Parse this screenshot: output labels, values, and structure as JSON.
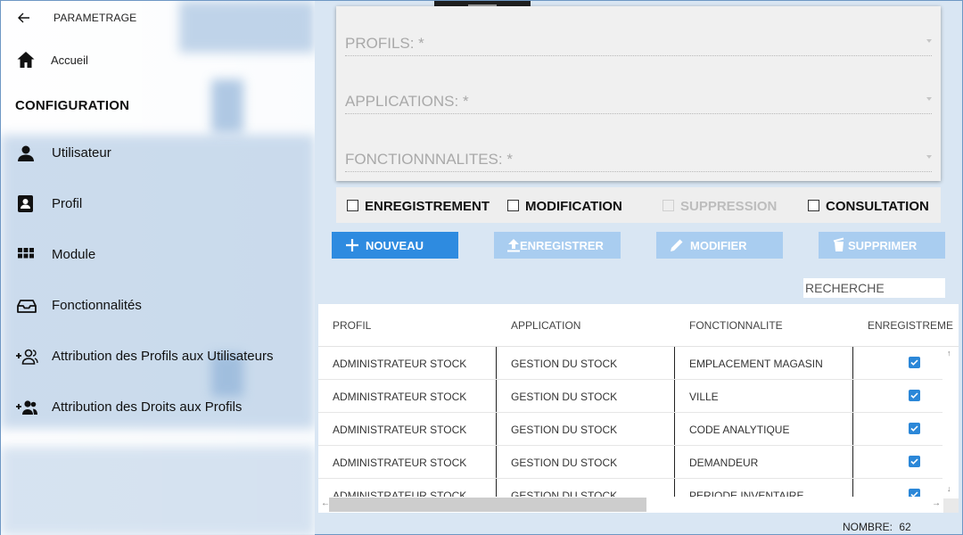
{
  "app": {
    "title": "PARAMETRAGE"
  },
  "nav": {
    "home_label": "Accueil",
    "section_title": "CONFIGURATION",
    "items": [
      {
        "label": "Utilisateur",
        "icon": "person-icon"
      },
      {
        "label": "Profil",
        "icon": "contact-card-icon"
      },
      {
        "label": "Module",
        "icon": "grid-icon"
      },
      {
        "label": "Fonctionnalités",
        "icon": "tray-icon"
      },
      {
        "label": "Attribution des Profils aux Utilisateurs",
        "icon": "add-group-icon"
      },
      {
        "label": "Attribution des Droits aux Profils",
        "icon": "add-people-icon"
      }
    ]
  },
  "form": {
    "profils_label": "PROFILS: *",
    "applications_label": "APPLICATIONS: *",
    "fonctionnalites_label": "FONCTIONNNALITES: *"
  },
  "rights": {
    "enregistrement": {
      "label": "ENREGISTREMENT",
      "checked": false,
      "enabled": true
    },
    "modification": {
      "label": "MODIFICATION",
      "checked": false,
      "enabled": true
    },
    "suppression": {
      "label": "SUPPRESSION",
      "checked": false,
      "enabled": false
    },
    "consultation": {
      "label": "CONSULTATION",
      "checked": false,
      "enabled": true
    }
  },
  "toolbar": {
    "nouveau": "NOUVEAU",
    "enregistrer": "ENREGISTRER",
    "modifier": "MODIFIER",
    "supprimer": "SUPPRIMER"
  },
  "search": {
    "placeholder": "RECHERCHE"
  },
  "table": {
    "columns": [
      "PROFIL",
      "APPLICATION",
      "FONCTIONNALITE",
      "ENREGISTREME"
    ],
    "rows": [
      {
        "profil": "ADMINISTRATEUR STOCK",
        "application": "GESTION DU STOCK",
        "fonctionnalite": "EMPLACEMENT MAGASIN",
        "enregistrement": true
      },
      {
        "profil": "ADMINISTRATEUR STOCK",
        "application": "GESTION DU STOCK",
        "fonctionnalite": "VILLE",
        "enregistrement": true
      },
      {
        "profil": "ADMINISTRATEUR STOCK",
        "application": "GESTION DU STOCK",
        "fonctionnalite": "CODE ANALYTIQUE",
        "enregistrement": true
      },
      {
        "profil": "ADMINISTRATEUR STOCK",
        "application": "GESTION DU STOCK",
        "fonctionnalite": "DEMANDEUR",
        "enregistrement": true
      },
      {
        "profil": "ADMINISTRATEUR STOCK",
        "application": "GESTION DU STOCK",
        "fonctionnalite": "PERIODE INVENTAIRE",
        "enregistrement": true
      }
    ]
  },
  "footer": {
    "count_label": "NOMBRE:",
    "count_value": "62"
  },
  "colors": {
    "accent": "#2e8be0",
    "accent_disabled": "#a9cdf0",
    "check_blue": "#2b87d8",
    "backdrop": "#d9e6f3"
  }
}
